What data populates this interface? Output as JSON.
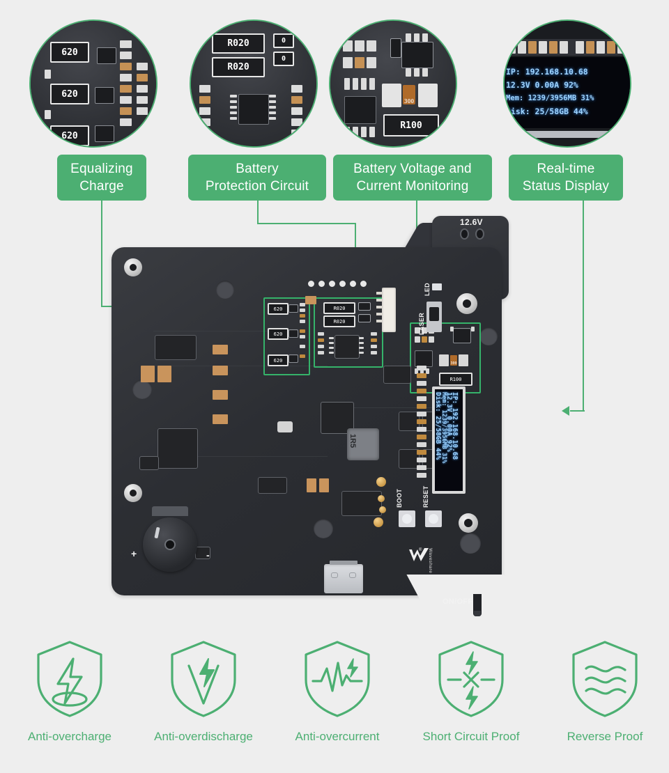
{
  "theme": {
    "background": "#eeeeee",
    "accent_green": "#4CAF72",
    "highlight_green": "#35b36a",
    "label_text": "#ffffff",
    "feature_text": "#4CAF72",
    "pcb_dark": "#2f3136",
    "oled_text": "#9fd4ff"
  },
  "callouts": [
    {
      "id": "equalizing-charge",
      "line1": "Equalizing",
      "line2": "Charge",
      "detail_parts": [
        "620",
        "620",
        "620"
      ]
    },
    {
      "id": "battery-protection-circuit",
      "line1": "Battery",
      "line2": "Protection Circuit",
      "detail_parts": [
        "R020",
        "R020",
        "0",
        "0"
      ]
    },
    {
      "id": "battery-voltage-current-monitoring",
      "line1": "Battery Voltage and",
      "line2": "Current Monitoring",
      "detail_parts": [
        "300",
        "R100"
      ]
    },
    {
      "id": "real-time-status-display",
      "line1": "Real-time",
      "line2": "Status Display",
      "detail_parts": []
    }
  ],
  "oled_display": {
    "lines": [
      "IP: 192.168.10.68",
      "12.3V   0.00A   92%",
      "Mem: 1239/3956MB 31%",
      "Disk: 25/58GB 44%"
    ],
    "ip": "192.168.10.68",
    "voltage": "12.3V",
    "current": "0.00A",
    "battery_percent": "92%",
    "mem_used": "1239",
    "mem_total": "3956MB",
    "mem_percent": "31%",
    "disk_used": "25",
    "disk_total": "58GB",
    "disk_percent": "44%"
  },
  "board": {
    "silkscreen": {
      "voltage_label": "12.6V",
      "led_label": "LED",
      "laser_label": "LASER",
      "boot_label": "BOOT",
      "reset_label": "RESET",
      "onoff_label": "ON/OFF",
      "plus_label": "+",
      "minus_label": "-",
      "inductor_label": "1R5",
      "brand": "Waveshare"
    },
    "board_parts": {
      "r020_a": "R020",
      "r020_b": "R020",
      "r100": "R100",
      "r620_a": "620",
      "r620_b": "620",
      "r620_c": "620",
      "fuse_300": "300"
    }
  },
  "features": [
    {
      "id": "anti-overcharge",
      "label": "Anti-overcharge",
      "icon": "shield-bolt-ground-icon"
    },
    {
      "id": "anti-overdischarge",
      "label": "Anti-overdischarge",
      "icon": "shield-bolt-v-icon"
    },
    {
      "id": "anti-overcurrent",
      "label": "Anti-overcurrent",
      "icon": "shield-waveform-icon"
    },
    {
      "id": "short-circuit-proof",
      "label": "Short Circuit Proof",
      "icon": "shield-short-circuit-icon"
    },
    {
      "id": "reverse-proof",
      "label": "Reverse Proof",
      "icon": "shield-waves-icon"
    }
  ]
}
